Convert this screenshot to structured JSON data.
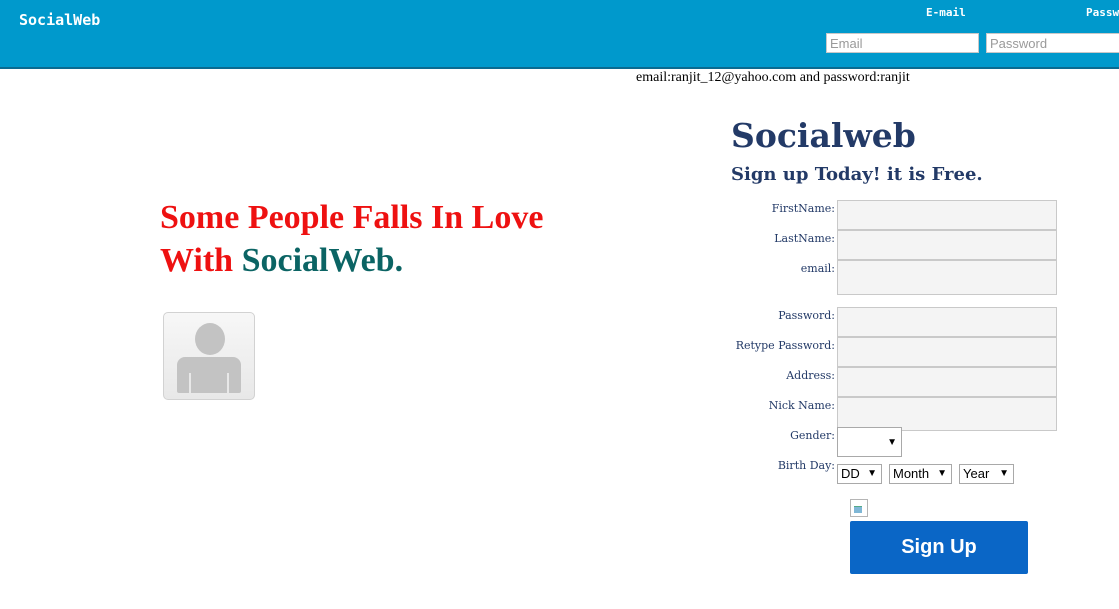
{
  "header": {
    "brand": "SocialWeb",
    "email_label": "E-mail",
    "password_label": "Password",
    "email_placeholder": "Email",
    "password_placeholder": "Password"
  },
  "hint": "email:ranjit_12@yahoo.com and password:ranjit",
  "hero": {
    "line1": "Some People Falls In Love",
    "line2_prefix": "With ",
    "line2_brand": "SocialWeb."
  },
  "signup": {
    "title": "Socialweb",
    "subtitle": "Sign up Today! it is Free.",
    "fields": {
      "first_name": "FirstName:",
      "last_name": "LastName:",
      "email": "email:",
      "password": "Password:",
      "retype_password": "Retype Password:",
      "address": "Address:",
      "nick_name": "Nick Name:",
      "gender": "Gender:",
      "birth_day": "Birth Day:"
    },
    "gender_value": "",
    "birth_dd": "DD",
    "birth_month": "Month",
    "birth_year": "Year",
    "submit_label": "Sign Up"
  },
  "colors": {
    "topbar": "#0099cc",
    "hero_red": "#ee1111",
    "hero_brand": "#0b6464",
    "form_title": "#233a67",
    "button": "#0a66c6"
  }
}
